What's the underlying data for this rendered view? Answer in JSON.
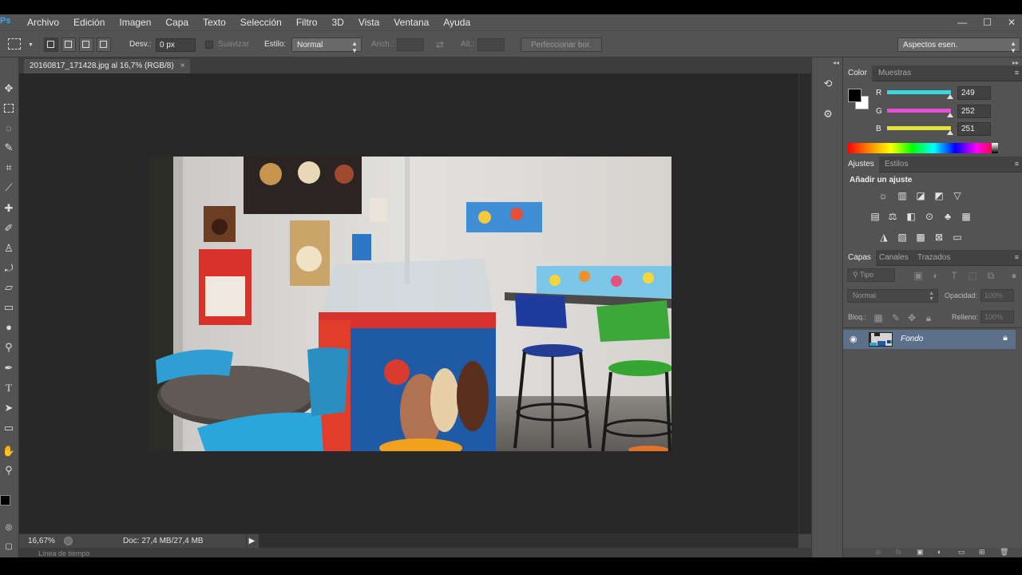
{
  "menubar": {
    "logo": "Ps",
    "items": [
      "Archivo",
      "Edición",
      "Imagen",
      "Capa",
      "Texto",
      "Selección",
      "Filtro",
      "3D",
      "Vista",
      "Ventana",
      "Ayuda"
    ],
    "window_controls": [
      "—",
      "☐",
      "✕"
    ]
  },
  "options": {
    "desv_label": "Desv.:",
    "desv_value": "0 px",
    "suavizar_label": "Suavizar",
    "estilo_label": "Estilo:",
    "estilo_value": "Normal",
    "anch_label": "Anch.:",
    "alt_label": "Alt.:",
    "refine_button": "Perfeccionar bor.",
    "workspace": "Aspectos esen."
  },
  "document": {
    "tab_title": "20160817_171428.jpg al 16,7% (RGB/8)",
    "tab_close": "×",
    "zoom": "16,67%",
    "doc_size": "Doc: 27,4 MB/27,4 MB",
    "timeline_label": "Línea de tiempo"
  },
  "color_panel": {
    "tabs": [
      "Color",
      "Muestras"
    ],
    "channels": [
      {
        "label": "R",
        "value": "249"
      },
      {
        "label": "G",
        "value": "252"
      },
      {
        "label": "B",
        "value": "251"
      }
    ],
    "colors": {
      "r_track": "#37d8e0",
      "g_track": "#e84fd8",
      "b_track": "#e2e23a",
      "foreground": "#000000",
      "background": "#ffffff"
    }
  },
  "adjust_panel": {
    "tabs": [
      "Ajustes",
      "Estilos"
    ],
    "heading": "Añadir un ajuste",
    "icons_row1": [
      "brightness-icon",
      "levels-icon",
      "curves-icon",
      "exposure-icon",
      "vibrance-icon"
    ],
    "icons_row2": [
      "hue-saturation-icon",
      "color-balance-icon",
      "black-white-icon",
      "photo-filter-icon",
      "channel-mixer-icon",
      "color-lookup-icon"
    ],
    "icons_row3": [
      "invert-icon",
      "posterize-icon",
      "threshold-icon",
      "selective-color-icon",
      "gradient-map-icon"
    ]
  },
  "layers_panel": {
    "tabs": [
      "Capas",
      "Canales",
      "Trazados"
    ],
    "filter_label": "Tipo",
    "blend_mode": "Normal",
    "opacity_label": "Opacidad:",
    "opacity_value": "100%",
    "lock_label": "Bloq.:",
    "fill_label": "Relleno:",
    "fill_value": "100%",
    "layers": [
      {
        "name": "Fondo",
        "visible": true,
        "locked": true
      }
    ]
  },
  "colors": {
    "ui_bg": "#535353",
    "canvas_bg": "#282828",
    "selected_layer": "#5d7089"
  }
}
